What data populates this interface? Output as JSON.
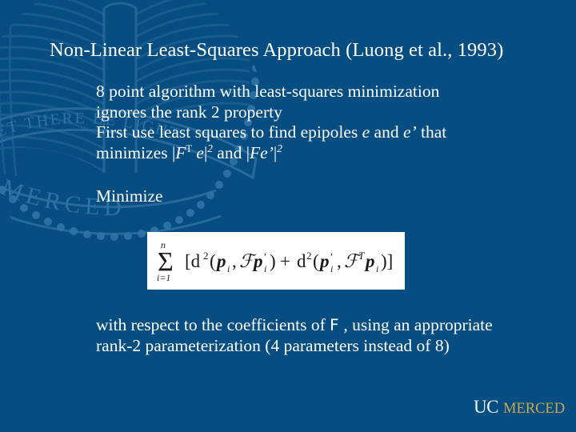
{
  "slide": {
    "background_color": "#064d82",
    "watermark_line_color": "#1a5c8e",
    "text_color": "#ffffff",
    "title": "Non-Linear Least-Squares Approach (Luong et al., 1993)"
  },
  "body": {
    "main": {
      "line1": "8 point algorithm with least-squares minimization",
      "line2": "ignores  the rank 2 property",
      "line3_a": "First use least squares to find epipoles ",
      "line3_e": "e",
      "line3_b": " and ",
      "line3_eprime": "e’",
      "line3_c": " that",
      "line4_a": "minimizes |",
      "line4_F": "F",
      "line4_T": "T",
      "line4_b": " ",
      "line4_e": "e",
      "line4_c": "|",
      "line4_sq1": "2",
      "line4_d": " and |",
      "line4_Feprime": "Fe’",
      "line4_f": "|",
      "line4_sq2": "2"
    },
    "minimize_label": "Minimize",
    "tail": {
      "part_a": "with respect to the coefficients of ",
      "part_F": "F",
      "part_b": " , using an appropriate rank-2 parameterization (4 parameters instead of 8)"
    }
  },
  "formula": {
    "description": "Sum from i equals 1 to n of bracket d squared of p sub i comma script-F p sub i prime, plus d squared of p sub i prime comma script-F transpose p sub i, close bracket",
    "sum_upper": "n",
    "sum_lower": "i=1",
    "latex": "\\sum_{i=1}^{n}\\left[\\mathrm{d}^2(\\boldsymbol{p}_i,\\mathcal{F}\\boldsymbol{p}'_i)+\\mathrm{d}^2(\\boldsymbol{p}'_i,\\mathcal{F}^T\\boldsymbol{p}_i)\\right]",
    "background_color": "#ffffff",
    "ink_color": "#1a1a1a"
  },
  "logo": {
    "uc_text": "UC",
    "merced_text": "MERCED",
    "uc_color": "#f2f4f5",
    "merced_color": "#c9a84c"
  },
  "watermark": {
    "banner_text": "LET THERE BE LIGHT",
    "arc_text": "MERCED"
  }
}
